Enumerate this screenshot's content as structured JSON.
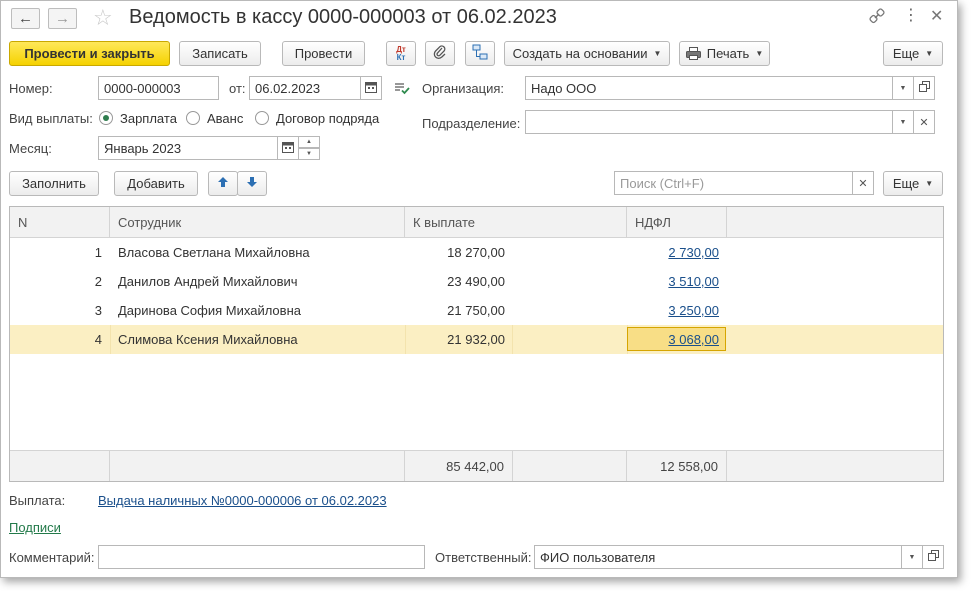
{
  "window": {
    "title": "Ведомость в кассу 0000-000003 от 06.02.2023"
  },
  "toolbar": {
    "post_close": "Провести и закрыть",
    "save": "Записать",
    "post": "Провести",
    "dtkt_top": "Дт",
    "dtkt_bottom": "Кт",
    "create_based": "Создать на основании",
    "print": "Печать",
    "more": "Еще"
  },
  "form": {
    "number_label": "Номер:",
    "number_value": "0000-000003",
    "date_label": "от:",
    "date_value": "06.02.2023",
    "org_label": "Организация:",
    "org_value": "Надо ООО",
    "payment_type_label": "Вид выплаты:",
    "payment_types": [
      "Зарплата",
      "Аванс",
      "Договор подряда"
    ],
    "payment_type_selected": "Зарплата",
    "department_label": "Подразделение:",
    "department_value": "",
    "month_label": "Месяц:",
    "month_value": "Январь 2023"
  },
  "table_toolbar": {
    "fill": "Заполнить",
    "add": "Добавить",
    "search_placeholder": "Поиск (Ctrl+F)",
    "more": "Еще"
  },
  "table": {
    "columns": [
      "N",
      "Сотрудник",
      "К выплате",
      "НДФЛ"
    ],
    "rows": [
      {
        "n": "1",
        "employee": "Власова Светлана Михайловна",
        "pay": "18 270,00",
        "ndfl": "2 730,00"
      },
      {
        "n": "2",
        "employee": "Данилов Андрей Михайлович",
        "pay": "23 490,00",
        "ndfl": "3 510,00"
      },
      {
        "n": "3",
        "employee": "Даринова София Михайловна",
        "pay": "21 750,00",
        "ndfl": "3 250,00"
      },
      {
        "n": "4",
        "employee": "Слимова Ксения Михайловна",
        "pay": "21 932,00",
        "ndfl": "3 068,00"
      }
    ],
    "selected_row": 4,
    "totals": {
      "pay": "85 442,00",
      "ndfl": "12 558,00"
    }
  },
  "footer": {
    "payment_label": "Выплата:",
    "payment_link": "Выдача наличных №0000-000006 от 06.02.2023",
    "signatures_link": "Подписи",
    "comment_label": "Комментарий:",
    "comment_value": "",
    "responsible_label": "Ответственный:",
    "responsible_value": "ФИО пользователя"
  },
  "colors": {
    "primary_button": "#f5d200",
    "selected_row": "#fbefc3",
    "link": "#1a4f8b",
    "link_green": "#237a4a"
  }
}
